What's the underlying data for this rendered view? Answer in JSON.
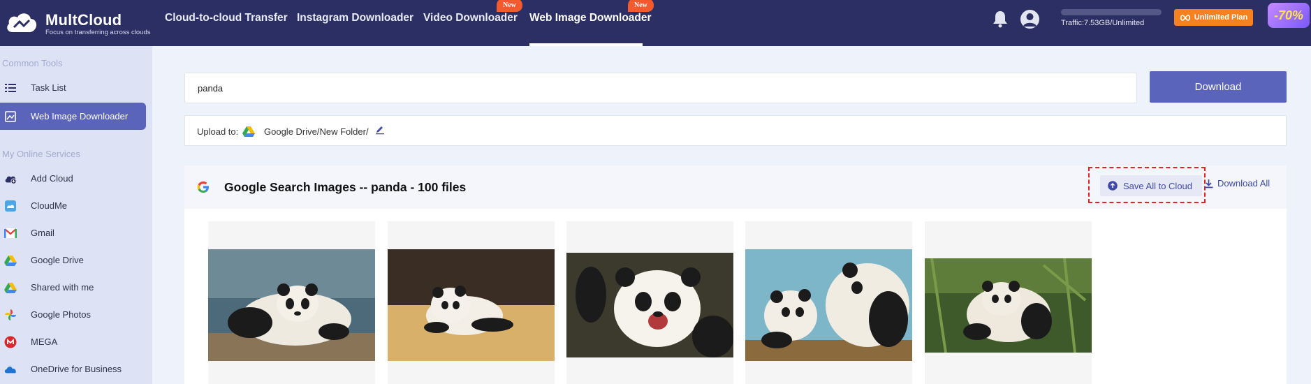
{
  "app": {
    "name": "MultCloud",
    "tagline": "Focus on transferring across clouds"
  },
  "nav": {
    "items": [
      {
        "label": "Cloud-to-cloud Transfer"
      },
      {
        "label": "Instagram Downloader"
      },
      {
        "label": "Video Downloader",
        "badge": "New"
      },
      {
        "label": "Web Image Downloader",
        "badge": "New",
        "active": true
      }
    ]
  },
  "header": {
    "traffic": "Traffic:7.53GB/Unlimited",
    "plan_button": "Unlimited Plan",
    "promo": "-70%"
  },
  "sidebar": {
    "common_tools": "Common Tools",
    "my_online_services": "My Online Services",
    "tools": [
      {
        "label": "Task List",
        "icon": "list-icon"
      },
      {
        "label": "Web Image Downloader",
        "icon": "image-icon",
        "active": true
      }
    ],
    "services": [
      {
        "label": "Add Cloud",
        "icon": "add-cloud-icon"
      },
      {
        "label": "CloudMe",
        "icon": "cloudme-icon"
      },
      {
        "label": "Gmail",
        "icon": "gmail-icon"
      },
      {
        "label": "Google Drive",
        "icon": "google-drive-icon"
      },
      {
        "label": "Shared with me",
        "icon": "shared-drive-icon"
      },
      {
        "label": "Google Photos",
        "icon": "google-photos-icon"
      },
      {
        "label": "MEGA",
        "icon": "mega-icon"
      },
      {
        "label": "OneDrive for Business",
        "icon": "onedrive-icon"
      }
    ]
  },
  "search": {
    "value": "panda",
    "download_button": "Download"
  },
  "upload": {
    "label": "Upload to:",
    "path": "Google Drive/New Folder/"
  },
  "results": {
    "title": "Google Search Images -- panda - 100 files",
    "save_all": "Save All to Cloud",
    "download_all": "Download All"
  },
  "colors": {
    "topbar": "#2b2f64",
    "accent": "#5a64bb",
    "badge": "#f35a2e",
    "plan": "#f5821f",
    "highlight": "#e52222"
  }
}
